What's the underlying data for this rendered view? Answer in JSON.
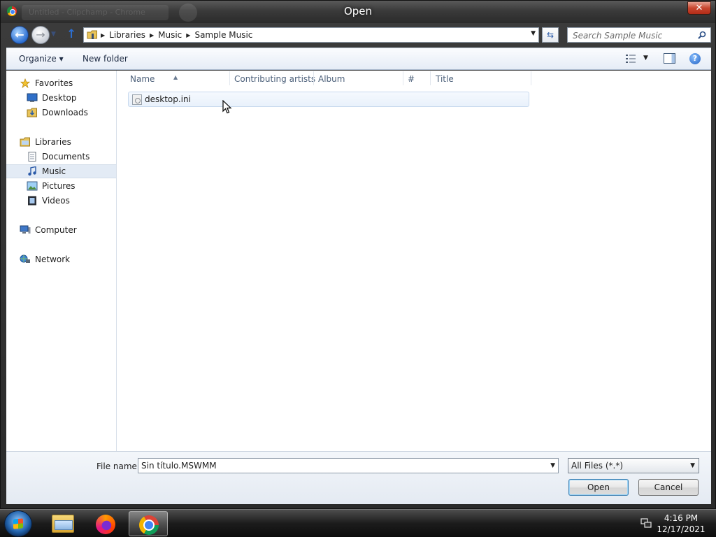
{
  "window": {
    "title": "Open",
    "background_tab_text": "Untitled - Clipchamp - Chrome",
    "close_glyph": "✕"
  },
  "nav": {
    "breadcrumbs": [
      "Libraries",
      "Music",
      "Sample Music"
    ],
    "search_placeholder": "Search Sample Music"
  },
  "toolbar": {
    "organize_label": "Organize ▾",
    "new_folder_label": "New folder"
  },
  "sidebar": {
    "favorites": {
      "label": "Favorites",
      "icon": "star-icon"
    },
    "favorites_items": [
      {
        "label": "Desktop",
        "icon": "desktop-icon"
      },
      {
        "label": "Downloads",
        "icon": "downloads-icon"
      }
    ],
    "libraries": {
      "label": "Libraries",
      "icon": "libraries-icon"
    },
    "libraries_items": [
      {
        "label": "Documents",
        "icon": "documents-icon"
      },
      {
        "label": "Music",
        "icon": "music-icon",
        "selected": true
      },
      {
        "label": "Pictures",
        "icon": "pictures-icon"
      },
      {
        "label": "Videos",
        "icon": "videos-icon"
      }
    ],
    "computer": {
      "label": "Computer",
      "icon": "computer-icon"
    },
    "network": {
      "label": "Network",
      "icon": "network-icon"
    }
  },
  "columns": [
    "Name",
    "Contributing artists",
    "Album",
    "#",
    "Title"
  ],
  "files": [
    {
      "name": "desktop.ini",
      "icon": "settings-file-icon"
    }
  ],
  "bottom": {
    "file_name_label": "File name:",
    "file_name_value": "Sin título.MSWMM",
    "file_type_value": "All Files (*.*)",
    "open_label": "Open",
    "cancel_label": "Cancel"
  },
  "taskbar": {
    "apps": [
      "Windows Explorer",
      "Firefox",
      "Google Chrome"
    ],
    "active_app": "Google Chrome",
    "time": "4:16 PM",
    "date": "12/17/2021"
  },
  "colors": {
    "accent": "#2c6ed1",
    "selection": "#e3ebf5",
    "close_red": "#c7462f"
  }
}
